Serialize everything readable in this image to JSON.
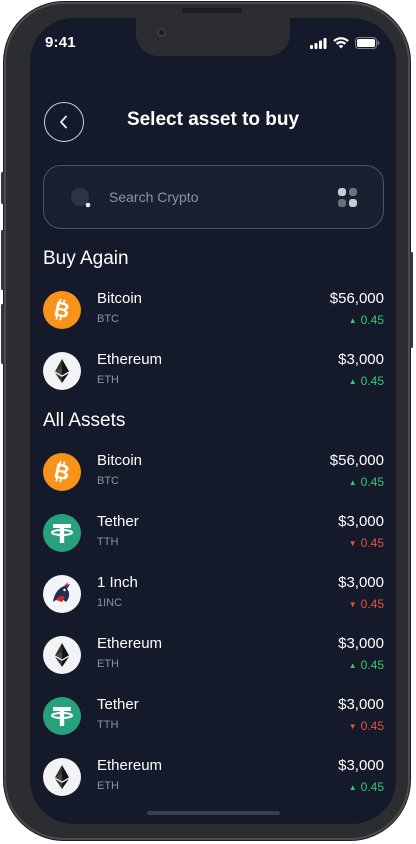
{
  "status_bar": {
    "time": "9:41"
  },
  "header": {
    "title": "Select asset to buy"
  },
  "search": {
    "placeholder": "Search Crypto"
  },
  "sections": {
    "buy_again": "Buy Again",
    "all_assets": "All Assets"
  },
  "buy_again": [
    {
      "name": "Bitcoin",
      "symbol": "BTC",
      "price": "$56,000",
      "change": "0.45",
      "direction": "up",
      "icon": "bitcoin-icon"
    },
    {
      "name": "Ethereum",
      "symbol": "ETH",
      "price": "$3,000",
      "change": "0.45",
      "direction": "up",
      "icon": "ethereum-icon"
    }
  ],
  "all_assets": [
    {
      "name": "Bitcoin",
      "symbol": "BTC",
      "price": "$56,000",
      "change": "0.45",
      "direction": "up",
      "icon": "bitcoin-icon"
    },
    {
      "name": "Tether",
      "symbol": "TTH",
      "price": "$3,000",
      "change": "0.45",
      "direction": "down",
      "icon": "tether-icon"
    },
    {
      "name": "1 Inch",
      "symbol": "1INC",
      "price": "$3,000",
      "change": "0.45",
      "direction": "down",
      "icon": "1inch-icon"
    },
    {
      "name": "Ethereum",
      "symbol": "ETH",
      "price": "$3,000",
      "change": "0.45",
      "direction": "up",
      "icon": "ethereum-icon"
    },
    {
      "name": "Tether",
      "symbol": "TTH",
      "price": "$3,000",
      "change": "0.45",
      "direction": "down",
      "icon": "tether-icon"
    },
    {
      "name": "Ethereum",
      "symbol": "ETH",
      "price": "$3,000",
      "change": "0.45",
      "direction": "up",
      "icon": "ethereum-icon"
    }
  ],
  "colors": {
    "background": "#141a2a",
    "up": "#37c871",
    "down": "#e5533c",
    "bitcoin": "#f7931a",
    "tether": "#26a17b"
  }
}
